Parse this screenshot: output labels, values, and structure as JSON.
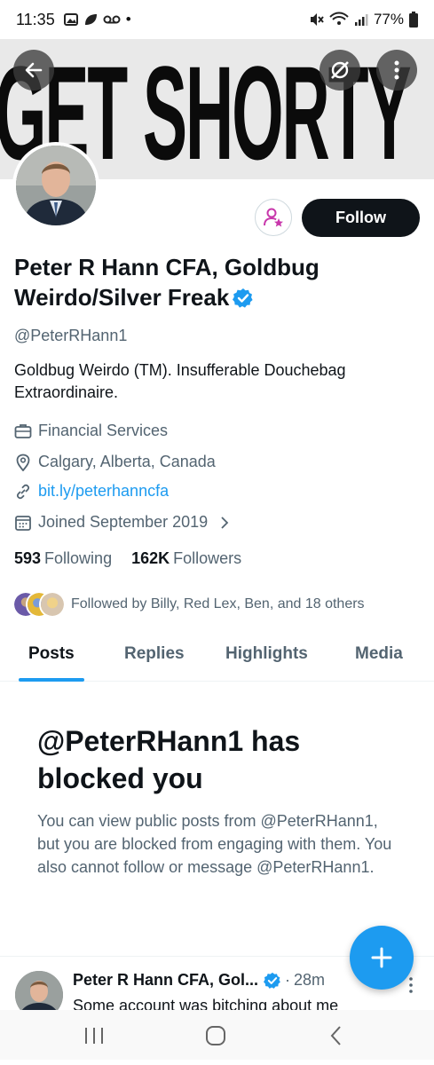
{
  "status_bar": {
    "time": "11:35",
    "dot": "•",
    "battery": "77%"
  },
  "banner": {
    "text": "GET SHORTY"
  },
  "profile": {
    "follow_label": "Follow",
    "name": "Peter R Hann CFA, Goldbug Weirdo/Silver Freak",
    "handle": "@PeterRHann1",
    "bio": "Goldbug Weirdo (TM). Insufferable Douchebag Extraordinaire.",
    "category": "Financial Services",
    "location": "Calgary, Alberta, Canada",
    "website": "bit.ly/peterhanncfa",
    "joined": "Joined September 2019",
    "following_count": "593",
    "following_label": "Following",
    "followers_count": "162K",
    "followers_label": "Followers",
    "followed_by": "Followed by Billy, Red Lex, Ben, and 18 others"
  },
  "tabs": [
    {
      "label": "Posts"
    },
    {
      "label": "Replies"
    },
    {
      "label": "Highlights"
    },
    {
      "label": "Media"
    }
  ],
  "blocked": {
    "title": "@PeterRHann1 has blocked you",
    "body": "You can view public posts from @PeterRHann1, but you are blocked from engaging with them. You also cannot follow or message @PeterRHann1."
  },
  "tweet": {
    "name": "Peter R Hann CFA, Gol...",
    "separator": "·",
    "time": "28m",
    "text": "Some account was bitching about me"
  },
  "colors": {
    "accent": "#1d9bf0",
    "text": "#0f1419",
    "muted": "#536471",
    "subscribe": "#c837ab"
  }
}
